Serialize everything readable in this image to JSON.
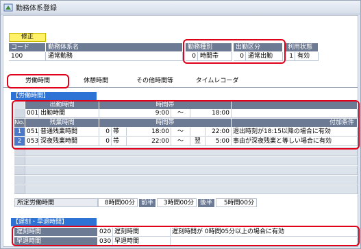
{
  "window": {
    "title": "勤務体系登録",
    "icon": "app-icon"
  },
  "header": {
    "badge": "修正",
    "columns": [
      "コード",
      "勤務体系名",
      "勤務種別",
      "出勤区分",
      "利用状態"
    ],
    "code": "100",
    "name": "通常勤務",
    "kind_code": "0",
    "kind": "時間帯",
    "attend_code": "0",
    "attend": "通常出勤",
    "status_code": "1",
    "status": "有効"
  },
  "tabs": [
    {
      "label": "労働時間",
      "active": true
    },
    {
      "label": "休憩時間",
      "active": false
    },
    {
      "label": "その他時間等",
      "active": false
    },
    {
      "label": "タイムレコーダ",
      "active": false
    }
  ],
  "work_section": {
    "title": "【労働時間】",
    "top_headers": [
      "出勤時間",
      "時間帯"
    ],
    "attend_row": {
      "code": "001",
      "name": "出勤時間",
      "start": "9:00",
      "sep": "〜",
      "end": "18:00"
    },
    "headers": [
      "No.",
      "残業時間",
      "時間帯",
      "付加条件"
    ],
    "rows": [
      {
        "no": "1",
        "code": "051",
        "name": "普通残業時間",
        "type_code": "0",
        "type": "帯",
        "start": "18:00",
        "sep": "〜",
        "next": "",
        "end": "22:00",
        "condition": "退出時刻が18:15以降の場合に有効"
      },
      {
        "no": "2",
        "code": "053",
        "name": "深夜残業時間",
        "type_code": "0",
        "type": "帯",
        "start": "22:00",
        "sep": "〜",
        "next": "翌",
        "end": "5:00",
        "condition": "事由が深夜残業と等しい場合に有効"
      }
    ]
  },
  "prescribed": {
    "label": "所定労働時間",
    "total": "8時間00分",
    "am_label": "前半",
    "am": "3時間00分",
    "pm_label": "後半",
    "pm": "5時間00分"
  },
  "late_section": {
    "title": "【遅刻・早退時間】",
    "rows": [
      {
        "label": "遅刻時間",
        "code": "020",
        "name": "遅刻時間",
        "condition": "遅刻時間が 0時間05分以上の場合に有効"
      },
      {
        "label": "早退時間",
        "code": "030",
        "name": "早退時間",
        "condition": ""
      }
    ]
  },
  "colors": {
    "highlight": "#e0001a",
    "header": "#6d7a93",
    "section": "#2d73d6",
    "badge": "#fff26a"
  }
}
